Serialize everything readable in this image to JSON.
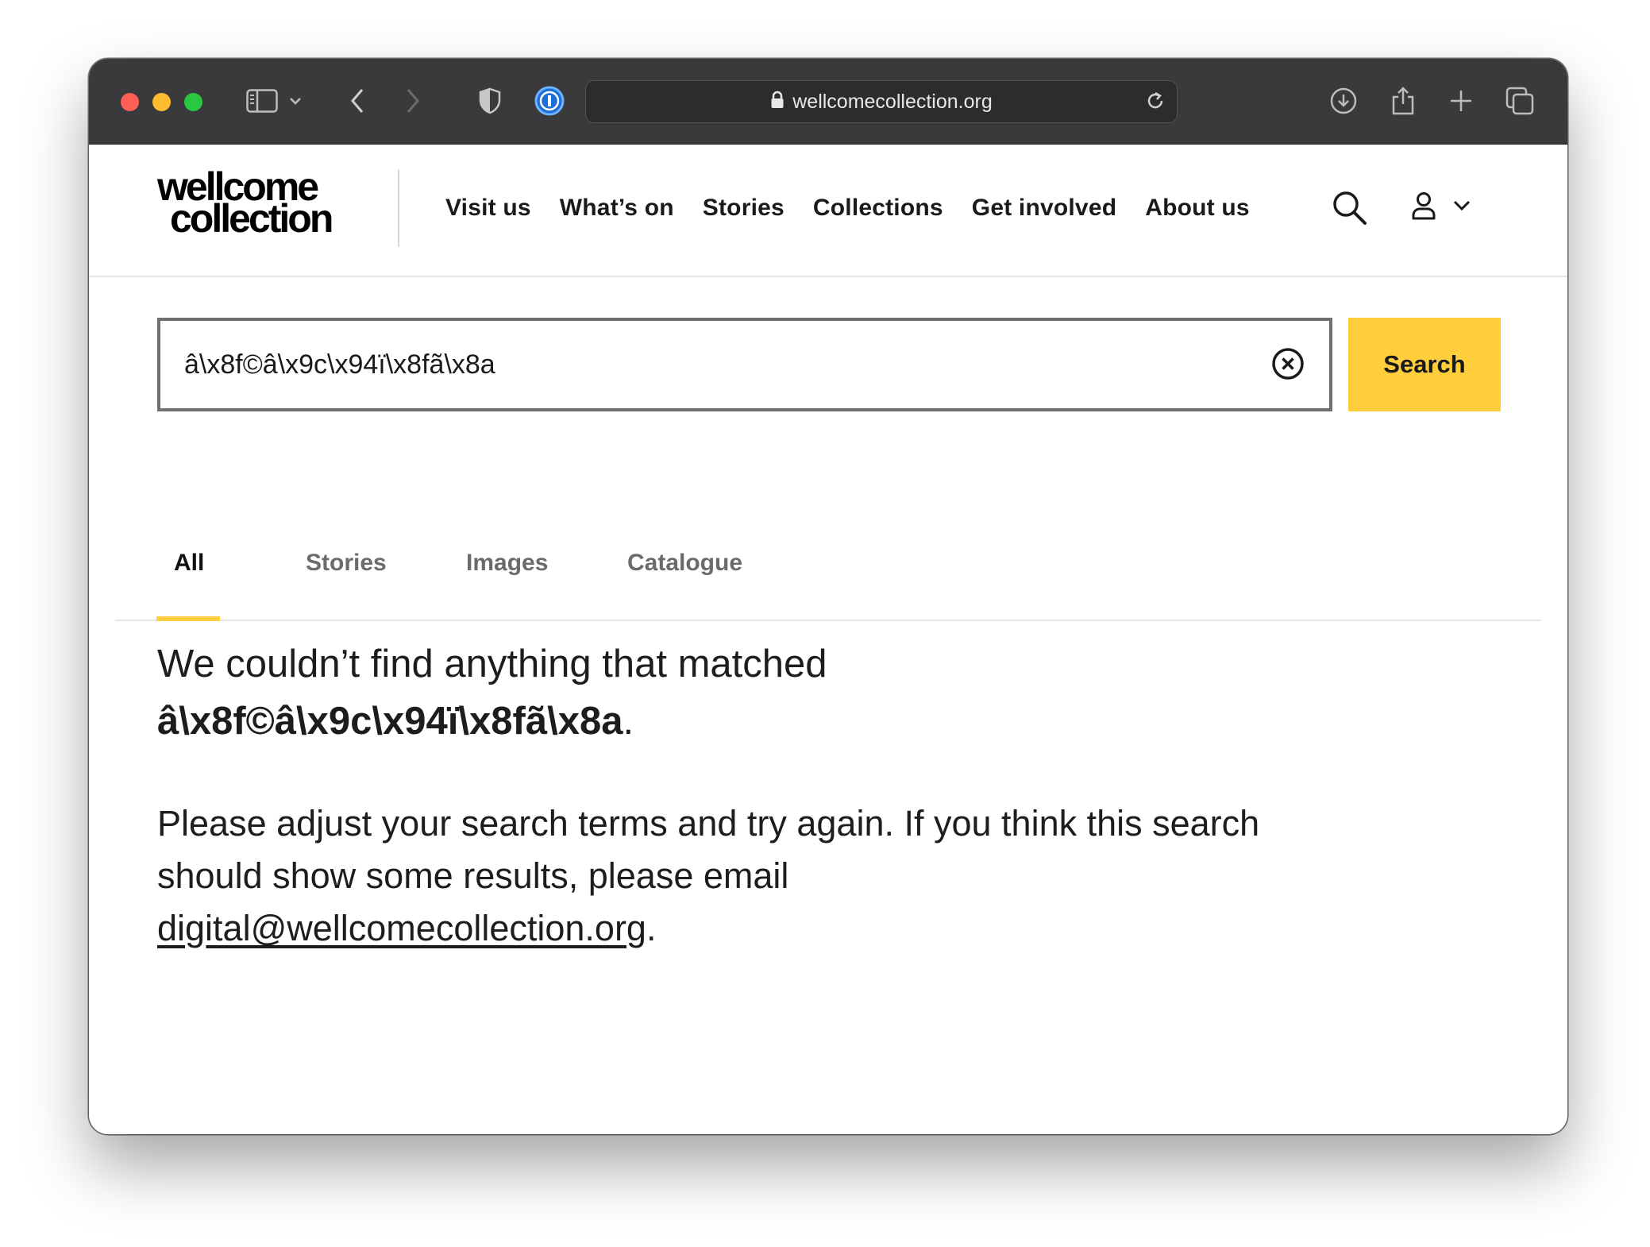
{
  "browser": {
    "url": "wellcomecollection.org"
  },
  "site": {
    "logo_line1": "wellcome",
    "logo_line2": "collection",
    "nav": [
      "Visit us",
      "What’s on",
      "Stories",
      "Collections",
      "Get involved",
      "About us"
    ]
  },
  "search": {
    "value": "â\\x8f©â\\x9c\\x94ï\\x8fã\\x8a",
    "button_label": "Search"
  },
  "tabs": [
    {
      "label": "All",
      "active": true
    },
    {
      "label": "Stories",
      "active": false
    },
    {
      "label": "Images",
      "active": false
    },
    {
      "label": "Catalogue",
      "active": false
    }
  ],
  "message": {
    "prefix": "We couldn’t find anything that matched",
    "query": "â\\x8f©â\\x9c\\x94ï\\x8fã\\x8a",
    "query_suffix": ".",
    "body": "Please adjust your search terms and try again. If you think this search should show some results, please email",
    "email": "digital@wellcomecollection.org",
    "body_suffix": "."
  },
  "colors": {
    "accent": "#ffce3c",
    "toolbar": "#3a3a3c"
  },
  "icons": [
    "sidebar-icon",
    "chevron-down-icon",
    "back-icon",
    "forward-icon",
    "shield-icon",
    "password-manager-icon",
    "lock-icon",
    "reload-icon",
    "download-icon",
    "share-icon",
    "new-tab-icon",
    "tabs-overview-icon",
    "search-icon",
    "user-icon",
    "clear-icon"
  ]
}
